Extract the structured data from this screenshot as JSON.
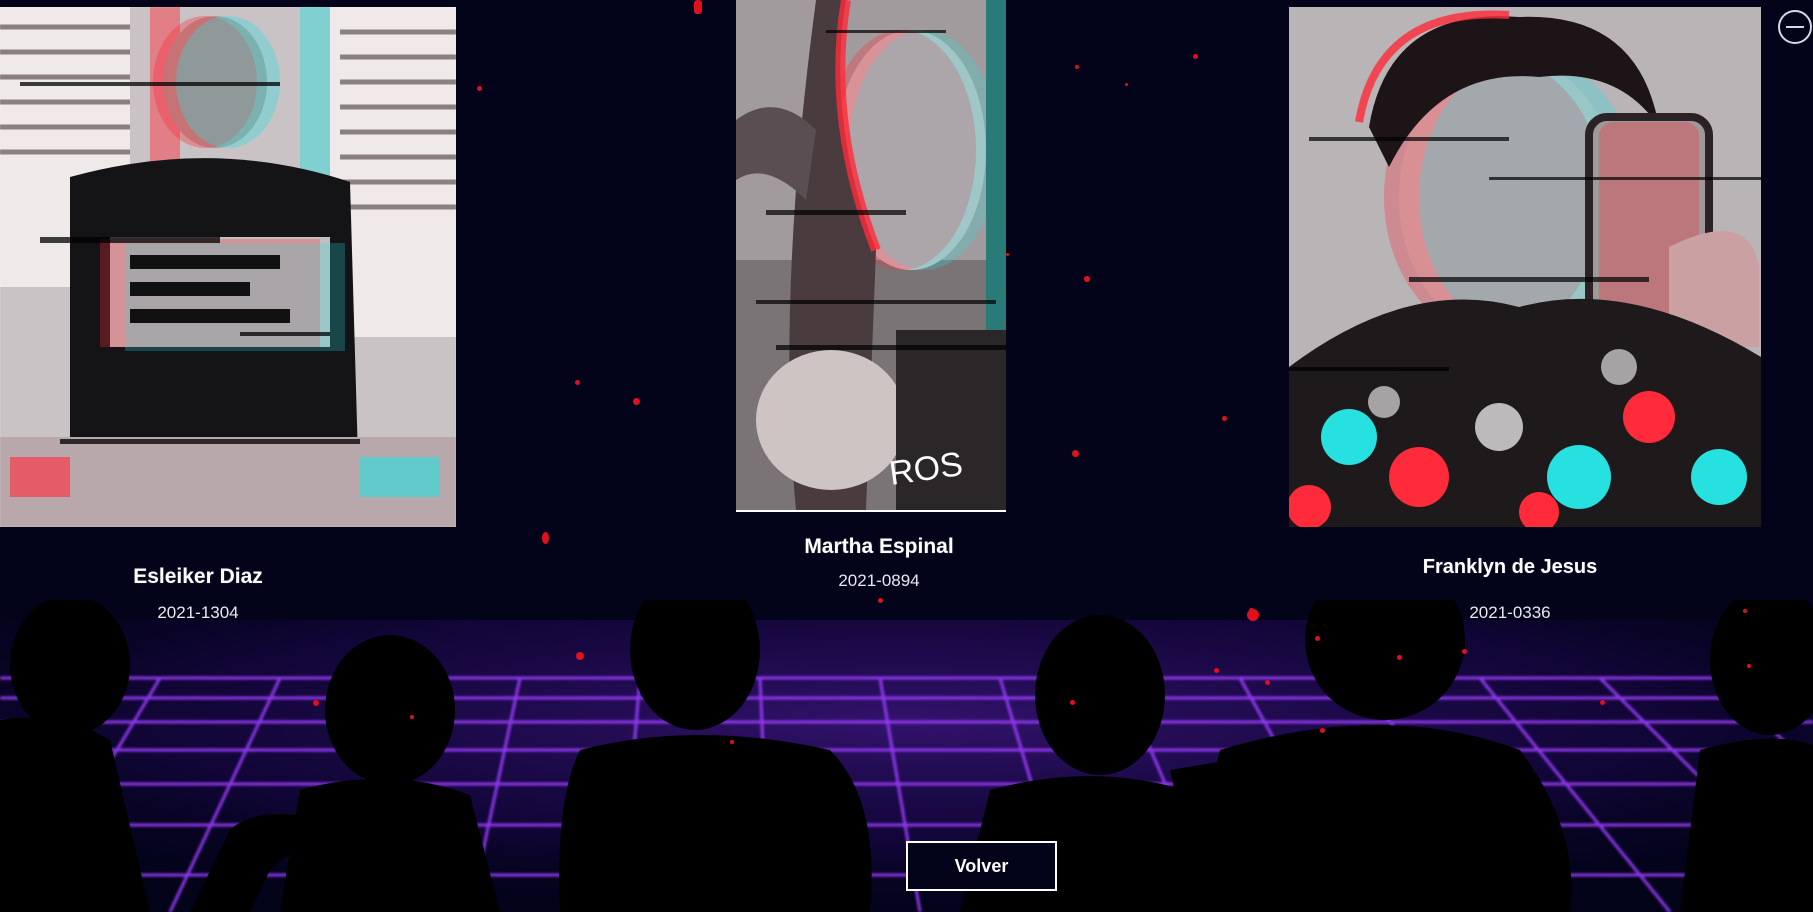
{
  "members": [
    {
      "name": "Esleiker Diaz",
      "id": "2021-1304",
      "photo_icon": "portrait-photo-glitch"
    },
    {
      "name": "Martha Espinal",
      "id": "2021-0894",
      "photo_icon": "portrait-photo-glitch"
    },
    {
      "name": "Franklyn de Jesus",
      "id": "2021-0336",
      "photo_icon": "portrait-photo-glitch"
    }
  ],
  "back_button": {
    "label": "Volver"
  },
  "corner_button": {
    "icon": "minus-circle-icon"
  },
  "theme": {
    "background": "#03031a",
    "grid_color": "#8a2be2",
    "particle_color": "#e0101e",
    "glitch_red": "#ff2a3a",
    "glitch_cyan": "#27e0e0"
  }
}
